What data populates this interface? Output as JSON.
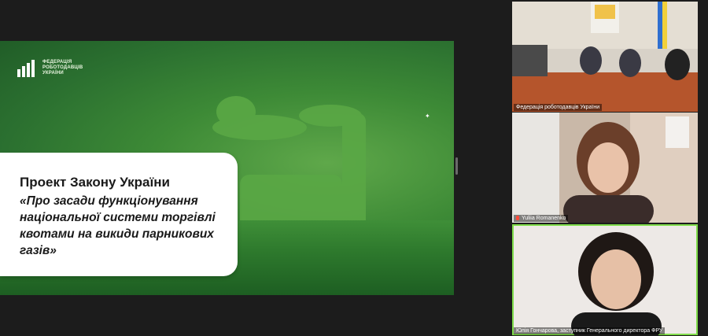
{
  "slide": {
    "logo_lines": [
      "ФЕДЕРАЦІЯ",
      "РОБОТОДАВЦІВ",
      "УКРАЇНИ"
    ],
    "title": "Проект Закону України",
    "subtitle": "«Про засади функціонування національної системи торгівлі квотами на викиди парникових газів»"
  },
  "participants": [
    {
      "name": "Федерація роботодавців України"
    },
    {
      "name": "Yuliia Romanenko",
      "muted": true
    },
    {
      "name": "Юлія Гончарова, заступник Генерального директора ФРУ"
    }
  ],
  "colors": {
    "active_speaker": "#7fdc4a",
    "slide_green": "#3d8a36"
  }
}
